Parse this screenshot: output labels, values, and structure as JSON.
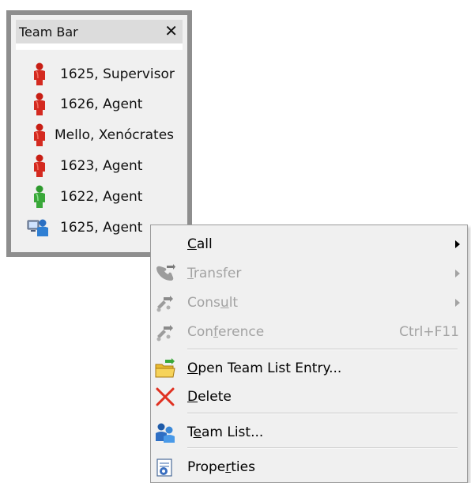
{
  "team_bar": {
    "title": "Team Bar",
    "close_glyph": "✕",
    "members": [
      {
        "name": "1625, Supervisor",
        "icon": "person-red-icon",
        "status_color": "#d42a20"
      },
      {
        "name": "1626, Agent",
        "icon": "person-red-icon",
        "status_color": "#d42a20"
      },
      {
        "name": "Mello, Xenócrates",
        "icon": "person-red-icon",
        "status_color": "#d42a20"
      },
      {
        "name": "1623, Agent",
        "icon": "person-red-icon",
        "status_color": "#d42a20"
      },
      {
        "name": "1622, Agent",
        "icon": "person-green-icon",
        "status_color": "#3aa83a"
      },
      {
        "name": "1625, Agent",
        "icon": "person-computer-icon",
        "status_color": "#2f7fd3"
      }
    ]
  },
  "context_menu": {
    "items": [
      {
        "key": "call",
        "label_pre": "",
        "label_u": "C",
        "label_post": "all",
        "enabled": true,
        "has_submenu": true,
        "shortcut": ""
      },
      {
        "key": "transfer",
        "label_pre": "",
        "label_u": "T",
        "label_post": "ransfer",
        "enabled": false,
        "has_submenu": true,
        "shortcut": ""
      },
      {
        "key": "consult",
        "label_pre": "Cons",
        "label_u": "u",
        "label_post": "lt",
        "enabled": false,
        "has_submenu": true,
        "shortcut": ""
      },
      {
        "key": "conference",
        "label_pre": "Con",
        "label_u": "f",
        "label_post": "erence",
        "enabled": false,
        "has_submenu": false,
        "shortcut": "Ctrl+F11"
      },
      {
        "key": "open",
        "label_pre": "",
        "label_u": "O",
        "label_post": "pen Team List Entry...",
        "enabled": true,
        "has_submenu": false,
        "shortcut": ""
      },
      {
        "key": "delete",
        "label_pre": "",
        "label_u": "D",
        "label_post": "elete",
        "enabled": true,
        "has_submenu": false,
        "shortcut": ""
      },
      {
        "key": "teamlist",
        "label_pre": "T",
        "label_u": "e",
        "label_post": "am List...",
        "enabled": true,
        "has_submenu": false,
        "shortcut": ""
      },
      {
        "key": "properties",
        "label_pre": "Prope",
        "label_u": "r",
        "label_post": "ties",
        "enabled": true,
        "has_submenu": false,
        "shortcut": ""
      }
    ]
  },
  "colors": {
    "disabled_text": "#a3a3a3",
    "menu_background": "#f0f0f0",
    "panel_border": "#8e8e8e"
  }
}
